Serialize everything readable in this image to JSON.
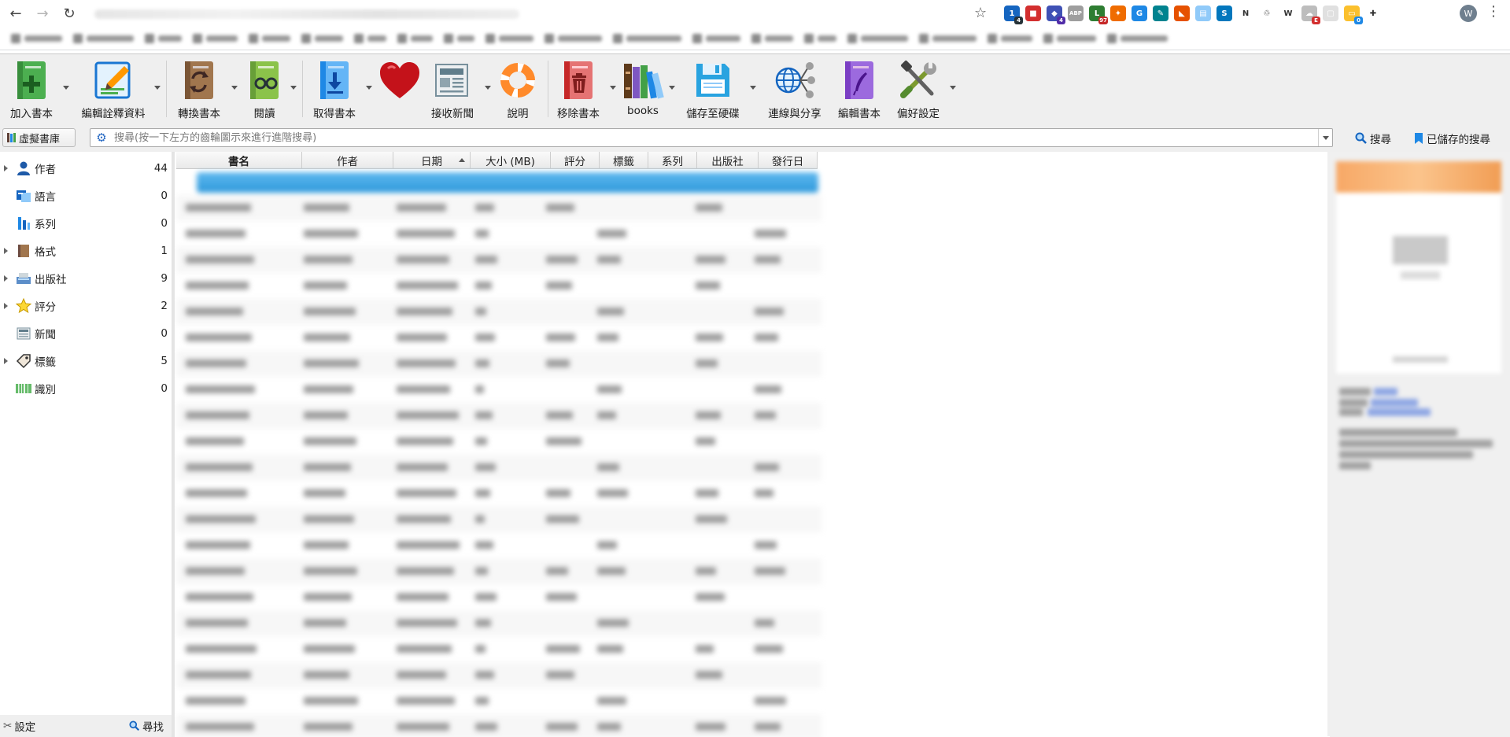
{
  "browser": {
    "back_icon": "←",
    "forward_icon": "→",
    "reload_icon": "↻",
    "star_icon": "☆",
    "avatar_letter": "W",
    "menu_icon": "⋮",
    "extensions": [
      {
        "name": "ext-1",
        "color": "#1565c0",
        "glyph": "1",
        "badge": "4",
        "badge_color": "#263238"
      },
      {
        "name": "ext-flag",
        "color": "#d32f2f",
        "glyph": "■",
        "badge": "",
        "badge_color": ""
      },
      {
        "name": "ext-cube",
        "color": "#3f51b5",
        "glyph": "◆",
        "badge": "4",
        "badge_color": "#512da8"
      },
      {
        "name": "ext-abp",
        "color": "#9e9e9e",
        "glyph": "ABP",
        "badge": "",
        "badge_color": ""
      },
      {
        "name": "ext-line",
        "color": "#2e7d32",
        "glyph": "L",
        "badge": "97",
        "badge_color": "#c62828"
      },
      {
        "name": "ext-megaphone",
        "color": "#ef6c00",
        "glyph": "✦",
        "badge": "",
        "badge_color": ""
      },
      {
        "name": "ext-translate",
        "color": "#1e88e5",
        "glyph": "G",
        "badge": "",
        "badge_color": ""
      },
      {
        "name": "ext-pen",
        "color": "#00838f",
        "glyph": "✎",
        "badge": "",
        "badge_color": ""
      },
      {
        "name": "ext-fox",
        "color": "#e65100",
        "glyph": "◣",
        "badge": "",
        "badge_color": ""
      },
      {
        "name": "ext-note",
        "color": "#90caf9",
        "glyph": "▤",
        "badge": "",
        "badge_color": ""
      },
      {
        "name": "ext-s",
        "color": "#0277bd",
        "glyph": "S",
        "badge": "",
        "badge_color": ""
      },
      {
        "name": "ext-n",
        "color": "#ffffff",
        "glyph": "N",
        "badge": "",
        "badge_color": ""
      },
      {
        "name": "ext-recycle",
        "color": "#ffffff",
        "glyph": "♲",
        "badge": "",
        "badge_color": ""
      },
      {
        "name": "ext-w",
        "color": "#ffffff",
        "glyph": "W",
        "badge": "",
        "badge_color": ""
      },
      {
        "name": "ext-cloud",
        "color": "#bdbdbd",
        "glyph": "☁",
        "badge": "E",
        "badge_color": "#d32f2f"
      },
      {
        "name": "ext-doc",
        "color": "#e0e0e0",
        "glyph": "▢",
        "badge": "",
        "badge_color": ""
      },
      {
        "name": "ext-folder",
        "color": "#fbc02d",
        "glyph": "▭",
        "badge": "0",
        "badge_color": "#1e88e5"
      },
      {
        "name": "ext-puzzle",
        "color": "#ffffff",
        "glyph": "✚",
        "badge": "",
        "badge_color": ""
      }
    ]
  },
  "toolbar": {
    "add_books": "加入書本",
    "edit_metadata": "編輯詮釋資料",
    "convert_books": "轉換書本",
    "view": "閱讀",
    "get_books": "取得書本",
    "fetch_news": "接收新聞",
    "help": "說明",
    "remove_books": "移除書本",
    "library": "books",
    "save_to_disk": "儲存至硬碟",
    "connect_share": "連線與分享",
    "edit_book": "編輯書本",
    "preferences": "偏好設定"
  },
  "searchbar": {
    "virtual_library": "虛擬書庫",
    "placeholder": "搜尋(按一下左方的齒輪圖示來進行進階搜尋)",
    "search_label": "搜尋",
    "saved_searches_label": "已儲存的搜尋"
  },
  "tag_browser": {
    "items": [
      {
        "label": "作者",
        "count": "44",
        "expandable": true,
        "icon": "user-icon"
      },
      {
        "label": "語言",
        "count": "0",
        "expandable": false,
        "icon": "language-icon"
      },
      {
        "label": "系列",
        "count": "0",
        "expandable": false,
        "icon": "series-icon"
      },
      {
        "label": "格式",
        "count": "1",
        "expandable": true,
        "icon": "format-book-icon"
      },
      {
        "label": "出版社",
        "count": "9",
        "expandable": true,
        "icon": "publisher-icon"
      },
      {
        "label": "評分",
        "count": "2",
        "expandable": true,
        "icon": "star-icon"
      },
      {
        "label": "新聞",
        "count": "0",
        "expandable": false,
        "icon": "news-icon"
      },
      {
        "label": "標籤",
        "count": "5",
        "expandable": true,
        "icon": "tag-icon"
      },
      {
        "label": "識別",
        "count": "0",
        "expandable": false,
        "icon": "barcode-icon"
      }
    ],
    "configure_label": "設定",
    "find_label": "尋找"
  },
  "book_list": {
    "columns": [
      "書名",
      "作者",
      "日期",
      "大小 (MB)",
      "評分",
      "標籤",
      "系列",
      "出版社",
      "發行日"
    ],
    "sorted_column": "日期"
  },
  "colors": {
    "selection": "#2f99db",
    "toolbar_bg": "#efefef"
  }
}
